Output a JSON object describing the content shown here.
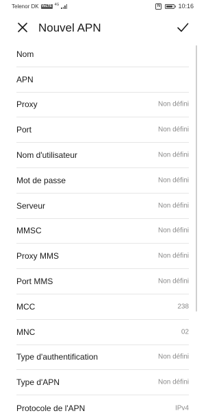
{
  "status_bar": {
    "carrier": "Telenor DK",
    "volte": "VoLTE",
    "network_type": "4G",
    "nfc": "N",
    "time": "10:16",
    "battery_level_percent": 85
  },
  "header": {
    "title": "Nouvel APN"
  },
  "fields": [
    {
      "label": "Nom",
      "value": ""
    },
    {
      "label": "APN",
      "value": ""
    },
    {
      "label": "Proxy",
      "value": "Non défini"
    },
    {
      "label": "Port",
      "value": "Non défini"
    },
    {
      "label": "Nom d'utilisateur",
      "value": "Non défini"
    },
    {
      "label": "Mot de passe",
      "value": "Non défini"
    },
    {
      "label": "Serveur",
      "value": "Non défini"
    },
    {
      "label": "MMSC",
      "value": "Non défini"
    },
    {
      "label": "Proxy MMS",
      "value": "Non défini"
    },
    {
      "label": "Port MMS",
      "value": "Non défini"
    },
    {
      "label": "MCC",
      "value": "238"
    },
    {
      "label": "MNC",
      "value": "02"
    },
    {
      "label": "Type d'authentification",
      "value": "Non défini"
    },
    {
      "label": "Type d'APN",
      "value": "Non défini"
    },
    {
      "label": "Protocole de l'APN",
      "value": "IPv4"
    }
  ],
  "icons": {
    "close": "close-icon",
    "confirm": "checkmark-icon"
  },
  "colors": {
    "background": "#ffffff",
    "text_primary": "#1a1a1a",
    "text_secondary": "#8a8a8a",
    "divider": "#e6e6e6"
  }
}
